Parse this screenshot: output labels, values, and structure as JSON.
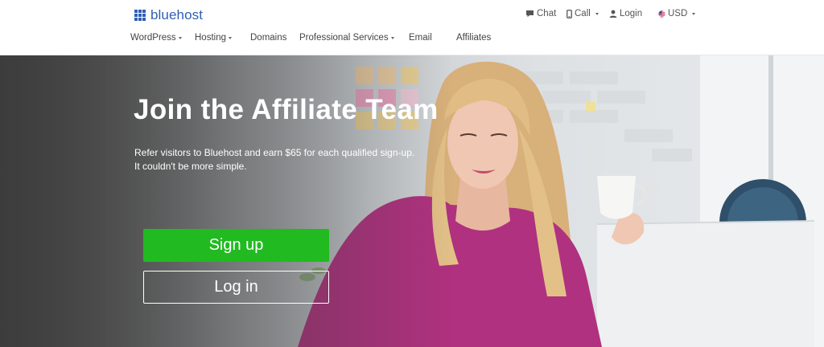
{
  "brand": {
    "name": "bluehost",
    "color": "#2f5fb4"
  },
  "utility": {
    "chat": {
      "label": "Chat",
      "icon": "chat-icon"
    },
    "call": {
      "label": "Call",
      "icon": "phone-icon"
    },
    "login": {
      "label": "Login",
      "icon": "user-icon"
    },
    "currency": {
      "label": "USD",
      "icon": "us-flag-icon"
    }
  },
  "nav": {
    "items": [
      {
        "label": "WordPress",
        "has_menu": true
      },
      {
        "label": "Hosting",
        "has_menu": true
      },
      {
        "label": "Domains",
        "has_menu": false
      },
      {
        "label": "Professional Services",
        "has_menu": true
      },
      {
        "label": "Email",
        "has_menu": false
      },
      {
        "label": "Affiliates",
        "has_menu": false
      }
    ]
  },
  "hero": {
    "title": "Join the Affiliate Team",
    "subtitle_line1": "Refer visitors to Bluehost and earn $65 for each qualified sign-up.",
    "subtitle_line2": "It couldn't be more simple.",
    "signup_label": "Sign up",
    "login_label": "Log in",
    "accent": "#21ba21"
  }
}
